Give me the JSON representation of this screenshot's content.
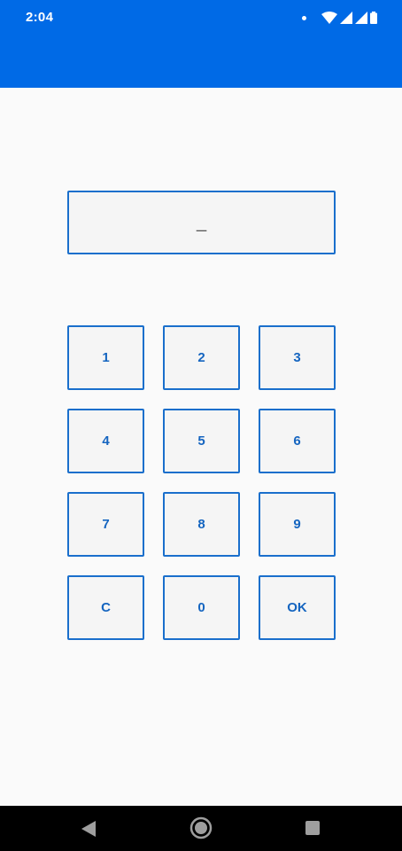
{
  "status_bar": {
    "time": "2:04",
    "background_color": "#006ae6",
    "icons": [
      "notification-dot-icon",
      "wifi-icon",
      "signal-icon",
      "signal-icon",
      "battery-icon"
    ]
  },
  "display": {
    "value": "_"
  },
  "keypad": {
    "keys": [
      "1",
      "2",
      "3",
      "4",
      "5",
      "6",
      "7",
      "8",
      "9",
      "C",
      "0",
      "OK"
    ]
  },
  "nav_bar": {
    "icons": [
      "back-icon",
      "home-icon",
      "recents-icon"
    ]
  },
  "colors": {
    "accent": "#1a6fcc",
    "key_text": "#1565c0",
    "key_background": "#f5f5f5",
    "page_background": "#fafafa"
  }
}
